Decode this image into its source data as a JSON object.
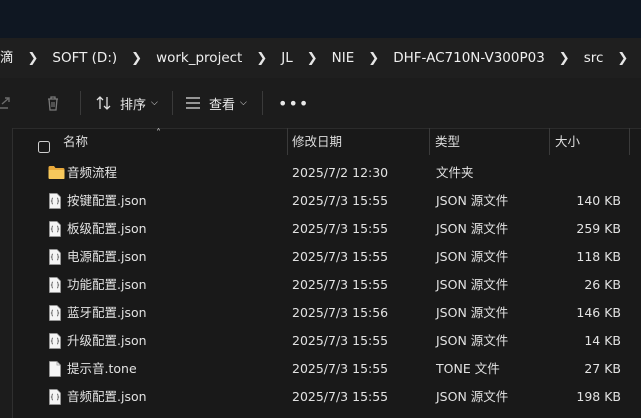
{
  "breadcrumb": [
    "SOFT (D:)",
    "work_project",
    "JL",
    "NIE",
    "DHF-AC710N-V300P03",
    "src"
  ],
  "breadcrumb_partial_first": "滴",
  "toolbar": {
    "sort_label": "排序",
    "view_label": "查看"
  },
  "columns": {
    "name": "名称",
    "date": "修改日期",
    "type": "类型",
    "size": "大小"
  },
  "files": [
    {
      "name": "音频流程",
      "date": "2025/7/2 12:30",
      "type": "文件夹",
      "size": "",
      "icon": "folder-icon"
    },
    {
      "name": "按键配置.json",
      "date": "2025/7/3 15:55",
      "type": "JSON 源文件",
      "size": "140 KB",
      "icon": "json-file-icon"
    },
    {
      "name": "板级配置.json",
      "date": "2025/7/3 15:55",
      "type": "JSON 源文件",
      "size": "259 KB",
      "icon": "json-file-icon"
    },
    {
      "name": "电源配置.json",
      "date": "2025/7/3 15:55",
      "type": "JSON 源文件",
      "size": "118 KB",
      "icon": "json-file-icon"
    },
    {
      "name": "功能配置.json",
      "date": "2025/7/3 15:55",
      "type": "JSON 源文件",
      "size": "26 KB",
      "icon": "json-file-icon"
    },
    {
      "name": "蓝牙配置.json",
      "date": "2025/7/3 15:56",
      "type": "JSON 源文件",
      "size": "146 KB",
      "icon": "json-file-icon"
    },
    {
      "name": "升级配置.json",
      "date": "2025/7/3 15:55",
      "type": "JSON 源文件",
      "size": "14 KB",
      "icon": "json-file-icon"
    },
    {
      "name": "提示音.tone",
      "date": "2025/7/3 15:55",
      "type": "TONE 文件",
      "size": "27 KB",
      "icon": "file-icon"
    },
    {
      "name": "音频配置.json",
      "date": "2025/7/3 15:55",
      "type": "JSON 源文件",
      "size": "198 KB",
      "icon": "json-file-icon"
    }
  ]
}
